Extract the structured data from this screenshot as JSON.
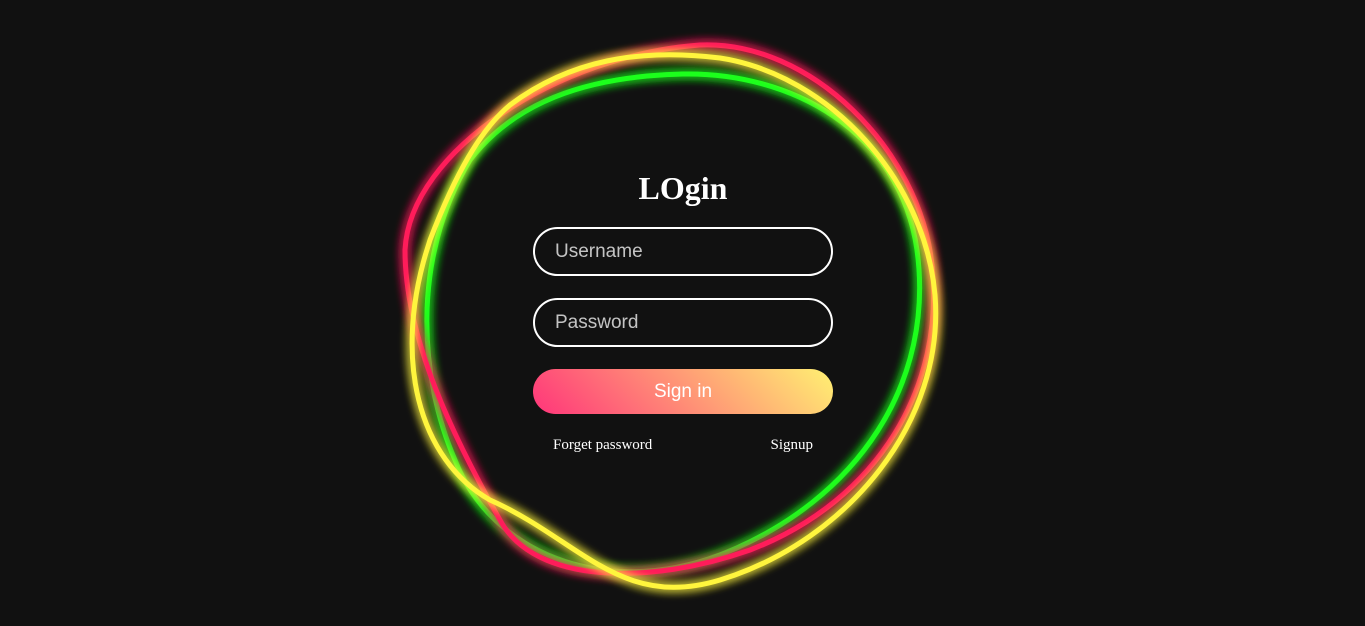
{
  "login": {
    "title": "LOgin",
    "username_placeholder": "Username",
    "password_placeholder": "Password",
    "signin_label": "Sign in",
    "forget_label": "Forget password",
    "signup_label": "Signup"
  },
  "rings": {
    "colors": {
      "red": "#ff1f5a",
      "green": "#1eff1e",
      "yellow": "#fff53d"
    }
  },
  "theme": {
    "background": "#111111",
    "button_gradient_start": "#ff357a",
    "button_gradient_end": "#fff172"
  }
}
